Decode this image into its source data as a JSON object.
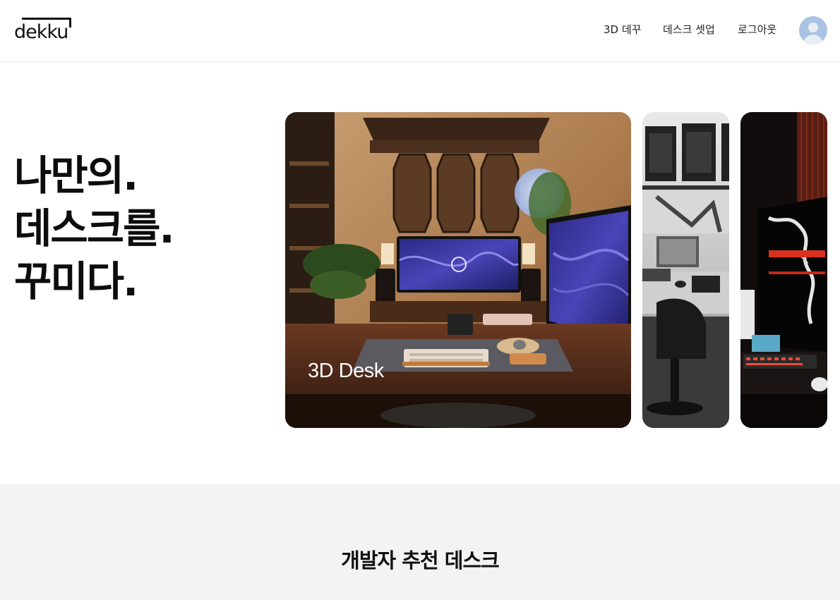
{
  "header": {
    "logo_text": "dekku",
    "nav": [
      {
        "label": "3D 데꾸"
      },
      {
        "label": "데스크 셋업"
      },
      {
        "label": "로그아웃"
      }
    ],
    "avatar_icon": "user-avatar-icon"
  },
  "hero": {
    "title_lines": [
      "나만의.",
      "데스크를.",
      "꾸미다."
    ],
    "cards": [
      {
        "label": "3D Desk",
        "image": "korean-themed desk setup photo"
      },
      {
        "label": "",
        "image": "monochrome desk setup photo"
      },
      {
        "label": "",
        "image": "dark red-lit gaming desk photo"
      }
    ]
  },
  "section": {
    "title": "개발자 추천 데스크"
  },
  "colors": {
    "background": "#ffffff",
    "section_background": "#f2f3f5",
    "avatar": "#a9c4e2",
    "text": "#111111"
  }
}
